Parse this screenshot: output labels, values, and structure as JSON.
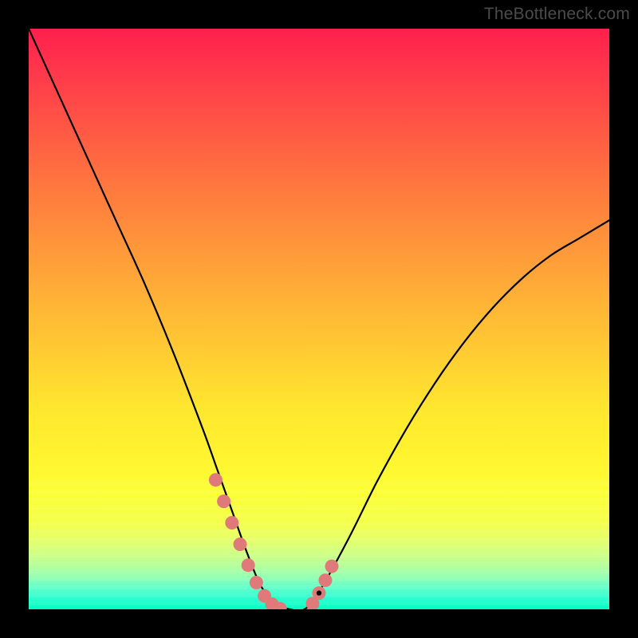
{
  "watermark": "TheBottleneck.com",
  "chart_data": {
    "type": "line",
    "title": "",
    "xlabel": "",
    "ylabel": "",
    "xlim": [
      0,
      100
    ],
    "ylim": [
      0,
      100
    ],
    "grid": false,
    "series": [
      {
        "name": "bottleneck-curve",
        "x": [
          0,
          5,
          10,
          15,
          20,
          25,
          30,
          32.5,
          35,
          37.5,
          40,
          42.5,
          45,
          47.5,
          50,
          55,
          60,
          65,
          70,
          75,
          80,
          85,
          90,
          95,
          100
        ],
        "y": [
          100,
          89,
          78,
          67,
          56,
          44,
          31,
          24,
          17,
          10,
          4,
          1,
          0,
          0,
          3,
          12,
          22,
          31,
          39,
          46,
          52,
          57,
          61,
          64,
          67
        ],
        "color": "#000000",
        "stroke_width": 2
      }
    ],
    "highlights": [
      {
        "name": "left-arm-markers",
        "color": "#e07a7a",
        "points": [
          {
            "x": 32.2,
            "y": 22.3
          },
          {
            "x": 33.6,
            "y": 18.6
          },
          {
            "x": 35.0,
            "y": 14.9
          },
          {
            "x": 36.4,
            "y": 11.2
          },
          {
            "x": 37.8,
            "y": 7.6
          },
          {
            "x": 39.2,
            "y": 4.6
          },
          {
            "x": 40.6,
            "y": 2.3
          },
          {
            "x": 41.9,
            "y": 0.9
          },
          {
            "x": 43.3,
            "y": 0.1
          }
        ]
      },
      {
        "name": "right-arm-markers",
        "color": "#e07a7a",
        "points": [
          {
            "x": 48.9,
            "y": 1.0
          },
          {
            "x": 50.0,
            "y": 2.8
          },
          {
            "x": 51.1,
            "y": 5.0
          },
          {
            "x": 52.2,
            "y": 7.4
          }
        ]
      }
    ],
    "elbow_point": {
      "x": 50.0,
      "y": 2.8,
      "color": "#000000"
    }
  },
  "colors": {
    "frame": "#000000",
    "curve": "#000000",
    "marker": "#e07a7a",
    "watermark": "#4b4b4b"
  }
}
